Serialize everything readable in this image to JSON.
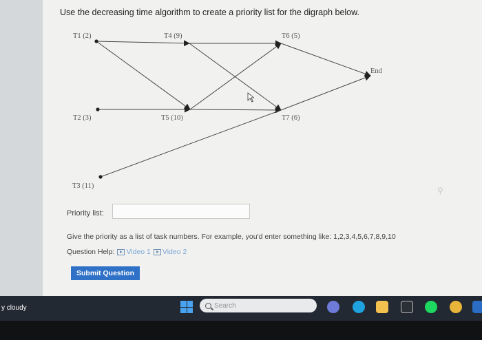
{
  "question": {
    "text": "Use the decreasing time algorithm to create a priority list for the digraph below."
  },
  "diagram": {
    "nodes": [
      {
        "id": "T1",
        "label": "T1 (2)"
      },
      {
        "id": "T4",
        "label": "T4 (9)"
      },
      {
        "id": "T6",
        "label": "T6 (5)"
      },
      {
        "id": "END",
        "label": "End"
      },
      {
        "id": "T2",
        "label": "T2 (3)"
      },
      {
        "id": "T5",
        "label": "T5 (10)"
      },
      {
        "id": "T7",
        "label": "T7 (6)"
      },
      {
        "id": "T3",
        "label": "T3 (11)"
      }
    ]
  },
  "form": {
    "priority_label": "Priority list:",
    "priority_value": "",
    "instructions": "Give the priority as a list of task numbers. For example, you'd enter something like: 1,2,3,4,5,6,7,8,9,10",
    "help_label": "Question Help:",
    "video1": "Video 1",
    "video2": "Video 2",
    "submit_label": "Submit Question"
  },
  "taskbar": {
    "weather": "y cloudy",
    "search_text": "Search"
  },
  "colors": {
    "accent": "#2f71c6",
    "taskbar": "#232933"
  }
}
